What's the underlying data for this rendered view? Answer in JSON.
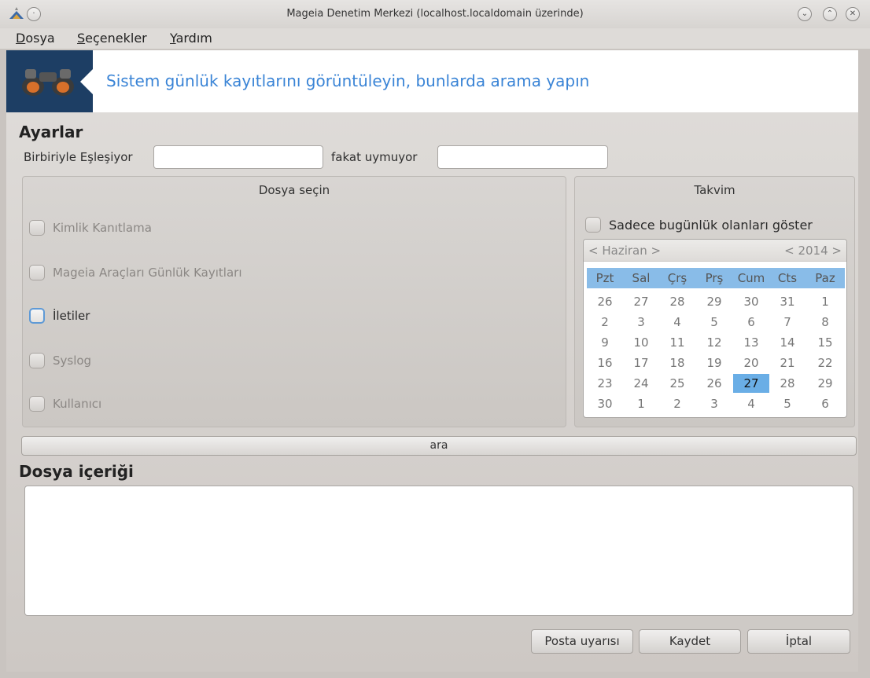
{
  "window": {
    "title": "Mageia Denetim Merkezi  (localhost.localdomain üzerinde)",
    "controls": {
      "minimize_icon": "⌄",
      "maximize_icon": "⌃",
      "close_icon": "✕"
    }
  },
  "menubar": {
    "items": [
      {
        "first": "D",
        "rest": "osya"
      },
      {
        "first": "S",
        "rest": "eçenekler"
      },
      {
        "first": "Y",
        "rest": "ardım"
      }
    ]
  },
  "banner": {
    "text": "Sistem günlük kayıtlarını görüntüleyin, bunlarda arama yapın",
    "icon": "binoculars-icon"
  },
  "settings": {
    "title": "Ayarlar",
    "match_label": "Birbiriyle Eşleşiyor",
    "match_value": "",
    "nomatch_label": "fakat uymuyor",
    "nomatch_value": ""
  },
  "file_select": {
    "title": "Dosya seçin",
    "items": [
      {
        "label": "Kimlik Kanıtlama",
        "checked": false,
        "enabled": false
      },
      {
        "label": "Mageia Araçları Günlük Kayıtları",
        "checked": false,
        "enabled": false
      },
      {
        "label": "İletiler",
        "checked": false,
        "enabled": true
      },
      {
        "label": "Syslog",
        "checked": false,
        "enabled": false
      },
      {
        "label": "Kullanıcı",
        "checked": false,
        "enabled": false
      }
    ]
  },
  "calendar": {
    "title": "Takvim",
    "today_only_label": "Sadece bugünlük olanları göster",
    "month": "Haziran",
    "year": "2014",
    "prev": "<",
    "next": ">",
    "weekdays": [
      "Pzt",
      "Sal",
      "Çrş",
      "Prş",
      "Cum",
      "Cts",
      "Paz"
    ],
    "weeks": [
      [
        "26",
        "27",
        "28",
        "29",
        "30",
        "31",
        "1"
      ],
      [
        "2",
        "3",
        "4",
        "5",
        "6",
        "7",
        "8"
      ],
      [
        "9",
        "10",
        "11",
        "12",
        "13",
        "14",
        "15"
      ],
      [
        "16",
        "17",
        "18",
        "19",
        "20",
        "21",
        "22"
      ],
      [
        "23",
        "24",
        "25",
        "26",
        "27",
        "28",
        "29"
      ],
      [
        "30",
        "1",
        "2",
        "3",
        "4",
        "5",
        "6"
      ]
    ],
    "selected_day": "27"
  },
  "search_button": "ara",
  "content": {
    "title": "Dosya içeriği",
    "text": ""
  },
  "buttons": {
    "mail_alert": "Posta uyarısı",
    "save": "Kaydet",
    "cancel": "İptal"
  }
}
